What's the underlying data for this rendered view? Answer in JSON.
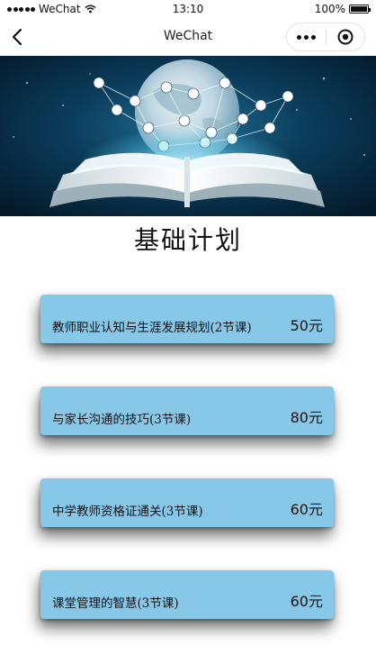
{
  "status_bar": {
    "carrier": "WeChat",
    "time": "13:10",
    "battery": "100%",
    "battery_level": 1.0
  },
  "nav": {
    "title": "WeChat",
    "back_icon": "chevron-left-icon",
    "more_icon": "more-dots-icon",
    "close_icon": "target-close-icon"
  },
  "page": {
    "title": "基础计划"
  },
  "courses": [
    {
      "name": "教师职业认知与生涯发展规划(2节课)",
      "price": "50元"
    },
    {
      "name": "与家长沟通的技巧(3节课)",
      "price": "80元"
    },
    {
      "name": "中学教师资格证通关(3节课)",
      "price": "60元"
    },
    {
      "name": "课堂管理的智慧(3节课)",
      "price": "60元"
    }
  ],
  "colors": {
    "card": "#87c8e9",
    "banner_dark": "#06243a",
    "banner_glow": "#5fd3f5"
  }
}
